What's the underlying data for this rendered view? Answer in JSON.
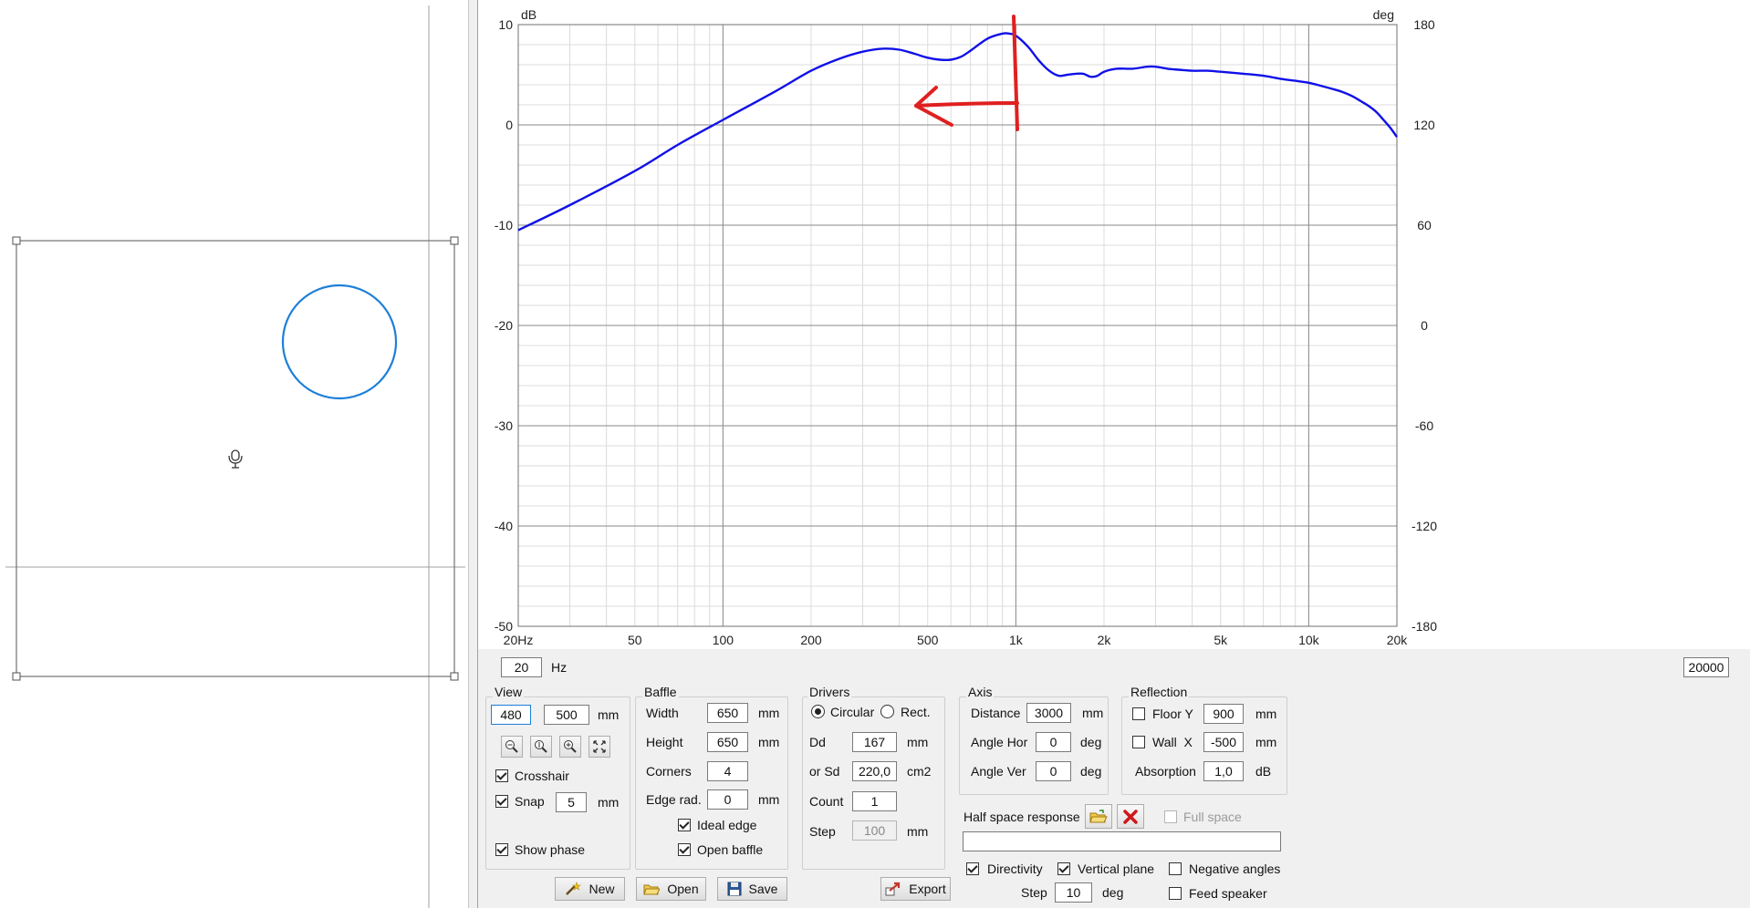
{
  "baffle_preview": {
    "mic_icon": "microphone-icon"
  },
  "chart_data": {
    "type": "line",
    "x_scale": "log",
    "xlim": [
      20,
      20000
    ],
    "ylim": [
      -50,
      10
    ],
    "y2lim": [
      -180,
      180
    ],
    "ylabel": "dB",
    "y2label": "deg",
    "x_ticks": [
      {
        "v": 20,
        "label": "20Hz"
      },
      {
        "v": 50,
        "label": "50"
      },
      {
        "v": 100,
        "label": "100"
      },
      {
        "v": 200,
        "label": "200"
      },
      {
        "v": 500,
        "label": "500"
      },
      {
        "v": 1000,
        "label": "1k"
      },
      {
        "v": 2000,
        "label": "2k"
      },
      {
        "v": 5000,
        "label": "5k"
      },
      {
        "v": 10000,
        "label": "10k"
      },
      {
        "v": 20000,
        "label": "20k"
      }
    ],
    "y_ticks": [
      {
        "v": 10,
        "label": "10"
      },
      {
        "v": 0,
        "label": "0"
      },
      {
        "v": -10,
        "label": "-10"
      },
      {
        "v": -20,
        "label": "-20"
      },
      {
        "v": -30,
        "label": "-30"
      },
      {
        "v": -40,
        "label": "-40"
      },
      {
        "v": -50,
        "label": "-50"
      }
    ],
    "y2_ticks": [
      {
        "v": 180,
        "label": "180"
      },
      {
        "v": 120,
        "label": "120"
      },
      {
        "v": 60,
        "label": "60"
      },
      {
        "v": 0,
        "label": "0"
      },
      {
        "v": -60,
        "label": "-60"
      },
      {
        "v": -120,
        "label": "-120"
      },
      {
        "v": -180,
        "label": "-180"
      }
    ],
    "grid": true,
    "series": [
      {
        "color": "#1010e8",
        "x": [
          20,
          30,
          50,
          70,
          100,
          150,
          200,
          250,
          300,
          350,
          400,
          450,
          500,
          550,
          600,
          650,
          700,
          800,
          900,
          950,
          1000,
          1100,
          1200,
          1300,
          1400,
          1500,
          1600,
          1700,
          1800,
          1900,
          2000,
          2200,
          2500,
          2800,
          3000,
          3300,
          3600,
          4000,
          4500,
          5000,
          6000,
          7000,
          8000,
          9000,
          10000,
          11000,
          12000,
          13000,
          14000,
          15000,
          16000,
          17000,
          18000,
          19000,
          20000
        ],
        "y": [
          -10.5,
          -8.0,
          -4.6,
          -2.0,
          0.5,
          3.3,
          5.4,
          6.6,
          7.3,
          7.6,
          7.5,
          7.1,
          6.7,
          6.5,
          6.5,
          6.8,
          7.4,
          8.6,
          9.1,
          9.1,
          8.9,
          7.8,
          6.4,
          5.4,
          4.9,
          5.0,
          5.1,
          5.1,
          4.8,
          4.9,
          5.3,
          5.6,
          5.6,
          5.8,
          5.8,
          5.6,
          5.5,
          5.4,
          5.4,
          5.3,
          5.1,
          4.9,
          4.6,
          4.4,
          4.2,
          3.9,
          3.6,
          3.3,
          2.9,
          2.4,
          1.9,
          1.3,
          0.5,
          -0.3,
          -1.2
        ]
      }
    ],
    "annotation": {
      "type": "red-arrow",
      "color": "#e02020"
    }
  },
  "freq_range": {
    "min": "20",
    "max": "20000",
    "unit": "Hz"
  },
  "view": {
    "title": "View",
    "width": "480",
    "height": "500",
    "unit": "mm",
    "zoom_icons": [
      "zoom-out-icon",
      "zoom-fit-height-icon",
      "zoom-in-icon",
      "fit-all-icon"
    ],
    "crosshair": {
      "label": "Crosshair",
      "checked": true
    },
    "snap": {
      "label": "Snap",
      "value": "5",
      "unit": "mm",
      "checked": true
    },
    "show_phase": {
      "label": "Show phase",
      "checked": true
    }
  },
  "baffle": {
    "title": "Baffle",
    "width": {
      "label": "Width",
      "value": "650",
      "unit": "mm"
    },
    "height": {
      "label": "Height",
      "value": "650",
      "unit": "mm"
    },
    "corners": {
      "label": "Corners",
      "value": "4"
    },
    "edge_rad": {
      "label": "Edge rad.",
      "value": "0",
      "unit": "mm"
    },
    "ideal_edge": {
      "label": "Ideal edge",
      "checked": true
    },
    "open_baffle": {
      "label": "Open baffle",
      "checked": true
    }
  },
  "drivers": {
    "title": "Drivers",
    "circular": {
      "label": "Circular",
      "checked": true
    },
    "rect": {
      "label": "Rect.",
      "checked": false
    },
    "dd": {
      "label": "Dd",
      "value": "167",
      "unit": "mm"
    },
    "sd": {
      "label": "or Sd",
      "value": "220,0",
      "unit": "cm2"
    },
    "count": {
      "label": "Count",
      "value": "1"
    },
    "step": {
      "label": "Step",
      "value": "100",
      "unit": "mm"
    }
  },
  "axis": {
    "title": "Axis",
    "distance": {
      "label": "Distance",
      "value": "3000",
      "unit": "mm"
    },
    "angle_hor": {
      "label": "Angle Hor",
      "value": "0",
      "unit": "deg"
    },
    "angle_ver": {
      "label": "Angle Ver",
      "value": "0",
      "unit": "deg"
    }
  },
  "reflection": {
    "title": "Reflection",
    "floor": {
      "label": "Floor Y",
      "value": "900",
      "unit": "mm",
      "checked": false
    },
    "wall": {
      "label": "Wall  X",
      "value": "-500",
      "unit": "mm",
      "checked": false
    },
    "absorption": {
      "label": "Absorption",
      "value": "1,0",
      "unit": "dB"
    }
  },
  "half_space": {
    "label": "Half space response",
    "open_icon": "folder-open-icon",
    "clear_icon": "red-x-icon",
    "full_space": {
      "label": "Full space",
      "checked": false
    },
    "path": ""
  },
  "directivity": {
    "directivity": {
      "label": "Directivity",
      "checked": true
    },
    "vertical_plane": {
      "label": "Vertical plane",
      "checked": true
    },
    "negative_angles": {
      "label": "Negative angles",
      "checked": false
    },
    "step": {
      "label": "Step",
      "value": "10",
      "unit": "deg"
    },
    "feed_speaker": {
      "label": "Feed speaker",
      "checked": false
    }
  },
  "buttons": {
    "new": {
      "label": "New",
      "icon": "magic-wand-icon"
    },
    "open": {
      "label": "Open",
      "icon": "folder-icon"
    },
    "save": {
      "label": "Save",
      "icon": "floppy-disk-icon"
    },
    "export": {
      "label": "Export",
      "icon": "export-arrow-icon"
    }
  }
}
